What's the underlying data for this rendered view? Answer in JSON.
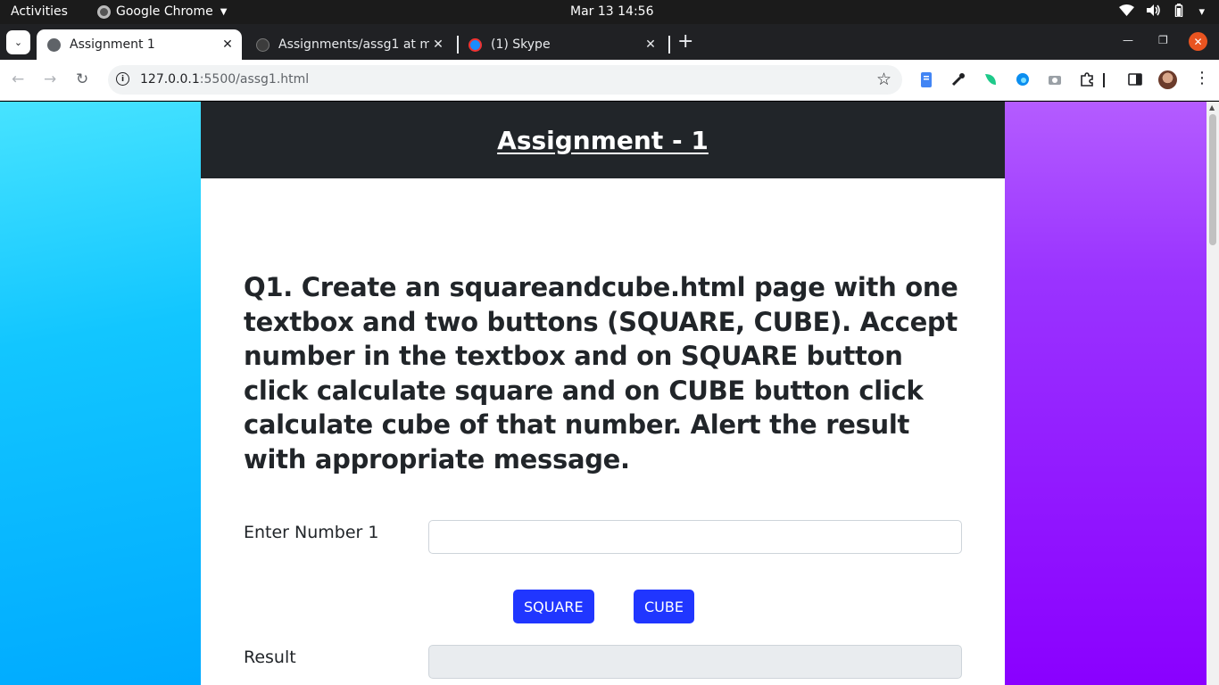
{
  "system_bar": {
    "activities": "Activities",
    "app_name": "Google Chrome",
    "clock": "Mar 13  14:56"
  },
  "browser": {
    "tabs": [
      {
        "title": "Assignment 1",
        "active": true,
        "icon": "globe-icon"
      },
      {
        "title": "Assignments/assg1 at m",
        "active": false,
        "icon": "github-icon"
      },
      {
        "title": "(1) Skype",
        "active": false,
        "icon": "skype-icon"
      }
    ],
    "url_host": "127.0.0.1",
    "url_path": ":5500/assg1.html"
  },
  "page": {
    "header_title": "Assignment - 1",
    "question": "Q1. Create an squareandcube.html page with one textbox and two buttons (SQUARE, CUBE). Accept number in the textbox and on SQUARE button click calculate square and on CUBE button click calculate cube of that number. Alert the result with appropriate message.",
    "number_label": "Enter Number 1",
    "number_value": "",
    "square_button": "SQUARE",
    "cube_button": "CUBE",
    "result_label": "Result",
    "result_value": ""
  },
  "colors": {
    "header_bg": "#212529",
    "button_bg": "#2036ff",
    "left_gradient": "#12c6ff",
    "right_gradient": "#8a00ff"
  }
}
